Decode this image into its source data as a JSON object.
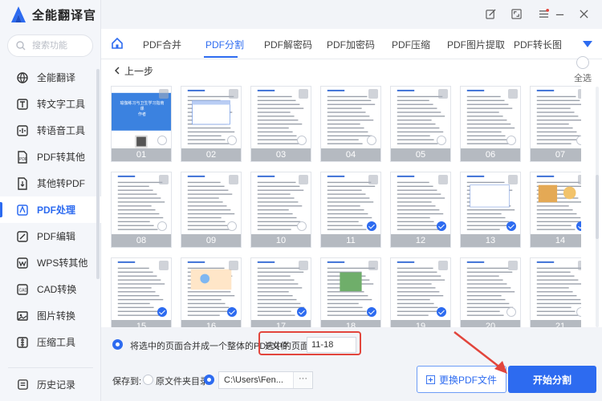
{
  "app": {
    "title": "全能翻译官"
  },
  "search": {
    "placeholder": "搜索功能"
  },
  "sidebar": {
    "items": [
      {
        "label": "全能翻译",
        "icon": "translate-icon"
      },
      {
        "label": "转文字工具",
        "icon": "text-tool-icon"
      },
      {
        "label": "转语音工具",
        "icon": "audio-tool-icon"
      },
      {
        "label": "PDF转其他",
        "icon": "pdf-convert-icon"
      },
      {
        "label": "其他转PDF",
        "icon": "to-pdf-icon"
      },
      {
        "label": "PDF处理",
        "icon": "pdf-process-icon"
      },
      {
        "label": "PDF编辑",
        "icon": "pdf-edit-icon"
      },
      {
        "label": "WPS转其他",
        "icon": "wps-icon"
      },
      {
        "label": "CAD转换",
        "icon": "cad-icon"
      },
      {
        "label": "图片转换",
        "icon": "image-convert-icon"
      },
      {
        "label": "压缩工具",
        "icon": "compress-icon"
      }
    ],
    "active_index": 5,
    "history_label": "历史记录"
  },
  "tabs": [
    "PDF合并",
    "PDF分割",
    "PDF解密码",
    "PDF加密码",
    "PDF压缩",
    "PDF图片提取",
    "PDF转长图"
  ],
  "active_tab": 1,
  "content": {
    "back_label": "上一步",
    "select_all_label": "全选",
    "thumb_cover_lines": [
      "瑜伽练习与卫生学习指南",
      "课",
      "作者"
    ],
    "pages": [
      {
        "num": "01",
        "checked": false
      },
      {
        "num": "02",
        "checked": false
      },
      {
        "num": "03",
        "checked": false
      },
      {
        "num": "04",
        "checked": false
      },
      {
        "num": "05",
        "checked": false
      },
      {
        "num": "06",
        "checked": false
      },
      {
        "num": "07",
        "checked": false
      },
      {
        "num": "08",
        "checked": false
      },
      {
        "num": "09",
        "checked": false
      },
      {
        "num": "10",
        "checked": false
      },
      {
        "num": "11",
        "checked": true
      },
      {
        "num": "12",
        "checked": true
      },
      {
        "num": "13",
        "checked": true
      },
      {
        "num": "14",
        "checked": true
      },
      {
        "num": "15",
        "checked": true
      },
      {
        "num": "16",
        "checked": true
      },
      {
        "num": "17",
        "checked": true
      },
      {
        "num": "18",
        "checked": true
      },
      {
        "num": "19",
        "checked": true
      },
      {
        "num": "20",
        "checked": false
      },
      {
        "num": "21",
        "checked": false
      }
    ]
  },
  "merge": {
    "label": "将选中的页面合并成一个整体的PDF文件",
    "selected_pages_label": "选中的页面:",
    "selected_pages_value": "11-18"
  },
  "save": {
    "label": "保存到:",
    "option_source": "原文件夹目录",
    "path": "C:\\Users\\Fen...",
    "more": "···"
  },
  "buttons": {
    "change_pdf": "更换PDF文件",
    "start_split": "开始分割"
  },
  "colors": {
    "accent": "#2d6bf0",
    "highlight": "#e2453c"
  }
}
